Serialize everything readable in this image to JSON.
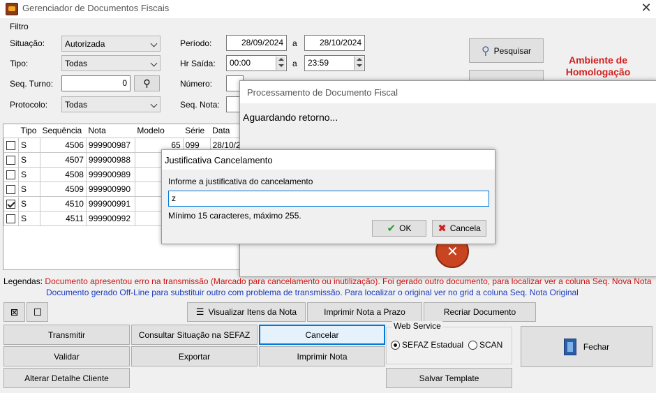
{
  "window": {
    "title": "Gerenciador de Documentos Fiscais"
  },
  "filter": {
    "group_label": "Filtro",
    "situacao_label": "Situação:",
    "situacao_value": "Autorizada",
    "tipo_label": "Tipo:",
    "tipo_value": "Todas",
    "seq_turno_label": "Seq. Turno:",
    "seq_turno_value": "0",
    "protocolo_label": "Protocolo:",
    "protocolo_value": "Todas",
    "periodo_label": "Período:",
    "periodo_from": "28/09/2024",
    "periodo_sep": "a",
    "periodo_to": "28/10/2024",
    "hr_saida_label": "Hr Saída:",
    "hr_from": "00:00",
    "hr_sep": "a",
    "hr_to": "23:59",
    "numero_label": "Número:",
    "seq_nota_label": "Seq. Nota:",
    "pesquisar_label": "Pesquisar",
    "ambiente_line1": "Ambiente de",
    "ambiente_line2": "Homologação"
  },
  "grid": {
    "headers": [
      "Tipo",
      "Sequência",
      "Nota",
      "Modelo",
      "Série",
      "Data"
    ],
    "rows": [
      {
        "checked": false,
        "tipo": "S",
        "seq": "4506",
        "nota": "999900987",
        "modelo": "65",
        "serie": "099",
        "data": "28/10/2"
      },
      {
        "checked": false,
        "tipo": "S",
        "seq": "4507",
        "nota": "999900988",
        "modelo": "",
        "serie": "",
        "data": ""
      },
      {
        "checked": false,
        "tipo": "S",
        "seq": "4508",
        "nota": "999900989",
        "modelo": "",
        "serie": "",
        "data": ""
      },
      {
        "checked": false,
        "tipo": "S",
        "seq": "4509",
        "nota": "999900990",
        "modelo": "",
        "serie": "",
        "data": ""
      },
      {
        "checked": true,
        "tipo": "S",
        "seq": "4510",
        "nota": "999900991",
        "modelo": "",
        "serie": "",
        "data": ""
      },
      {
        "checked": false,
        "tipo": "S",
        "seq": "4511",
        "nota": "999900992",
        "modelo": "",
        "serie": "",
        "data": ""
      }
    ]
  },
  "legend": {
    "label": "Legendas:",
    "red_text": "Documento apresentou erro na transmissão (Marcado para cancelamento ou inutilização). Foi gerado outro documento, para localizar ver a coluna Seq. Nova Nota",
    "blue_text": "Documento gerado Off-Line para substituir outro com problema  de transmissão. Para localizar o original ver no grid a coluna Seq. Nota Original"
  },
  "actions": {
    "visualizar": "Visualizar Itens da Nota",
    "imprimir_prazo": "Imprimir Nota a Prazo",
    "recriar": "Recriar Documento",
    "transmitir": "Transmitir",
    "consultar": "Consultar Situação na SEFAZ",
    "cancelar": "Cancelar",
    "validar": "Validar",
    "exportar": "Exportar",
    "imprimir": "Imprimir Nota",
    "alterar": "Alterar Detalhe Cliente",
    "salvar": "Salvar Template",
    "fechar": "Fechar"
  },
  "webservice": {
    "label": "Web Service",
    "opt1": "SEFAZ Estadual",
    "opt2": "SCAN",
    "selected": "SEFAZ Estadual"
  },
  "processing_dialog": {
    "title": "Processamento de Documento Fiscal",
    "message": "Aguardando retorno..."
  },
  "justify_dialog": {
    "title": "Justificativa Cancelamento",
    "prompt": "Informe a justificativa do cancelamento",
    "input_value": "z",
    "hint": "Mínimo 15 caracteres, máximo 255.",
    "ok": "OK",
    "cancel": "Cancela"
  },
  "colors": {
    "ambiente": "#d12020",
    "legend_red": "#d01010",
    "legend_blue": "#1a3cc0"
  }
}
